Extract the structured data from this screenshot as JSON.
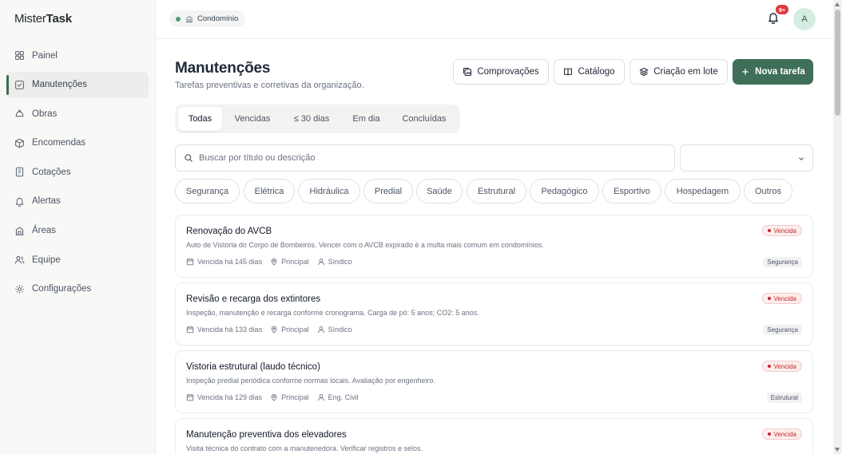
{
  "brand": {
    "part1": "Mister",
    "part2": "Task"
  },
  "sidebar": {
    "items": [
      {
        "label": "Painel",
        "icon": "grid-icon",
        "active": false
      },
      {
        "label": "Manutenções",
        "icon": "checkbox-icon",
        "active": true
      },
      {
        "label": "Obras",
        "icon": "helmet-icon",
        "active": false
      },
      {
        "label": "Encomendas",
        "icon": "package-icon",
        "active": false
      },
      {
        "label": "Cotações",
        "icon": "receipt-icon",
        "active": false
      },
      {
        "label": "Alertas",
        "icon": "bell-icon",
        "active": false
      },
      {
        "label": "Áreas",
        "icon": "building-icon",
        "active": false
      },
      {
        "label": "Equipe",
        "icon": "users-icon",
        "active": false
      },
      {
        "label": "Configurações",
        "icon": "gear-icon",
        "active": false
      }
    ]
  },
  "header": {
    "org_label": "Condomínio",
    "notification_badge": "9+",
    "avatar_initial": "A"
  },
  "page": {
    "title": "Manutenções",
    "subtitle": "Tarefas preventivas e corretivas da organização."
  },
  "actions": {
    "comprovacoes": "Comprovações",
    "catalogo": "Catálogo",
    "criacao_lote": "Criação em lote",
    "nova_tarefa": "Nova tarefa"
  },
  "tabs": [
    {
      "label": "Todas",
      "active": true
    },
    {
      "label": "Vencidas",
      "active": false
    },
    {
      "label": "≤ 30 dias",
      "active": false
    },
    {
      "label": "Em dia",
      "active": false
    },
    {
      "label": "Concluídas",
      "active": false
    }
  ],
  "search": {
    "placeholder": "Buscar por título ou descrição",
    "value": ""
  },
  "filter_select": {
    "value": ""
  },
  "categories": [
    "Segurança",
    "Elétrica",
    "Hidráulica",
    "Predial",
    "Saúde",
    "Estrutural",
    "Pedagógico",
    "Esportivo",
    "Hospedagem",
    "Outros"
  ],
  "tasks": [
    {
      "title": "Renovação do AVCB",
      "description": "Auto de Vistoria do Corpo de Bombeiros. Vencer com o AVCB expirado é a multa mais comum em condomínios.",
      "due": "Vencida há 145 dias",
      "location": "Principal",
      "responsible": "Síndico",
      "status": "Vencida",
      "category": "Segurança"
    },
    {
      "title": "Revisão e recarga dos extintores",
      "description": "Inspeção, manutenção e recarga conforme cronograma. Carga de pó: 5 anos; CO2: 5 anos.",
      "due": "Vencida há 133 dias",
      "location": "Principal",
      "responsible": "Síndico",
      "status": "Vencida",
      "category": "Segurança"
    },
    {
      "title": "Vistoria estrutural (laudo técnico)",
      "description": "Inspeção predial periódica conforme normas locais. Avaliação por engenheiro.",
      "due": "Vencida há 129 dias",
      "location": "Principal",
      "responsible": "Eng. Civil",
      "status": "Vencida",
      "category": "Estrutural"
    },
    {
      "title": "Manutenção preventiva dos elevadores",
      "description": "Visita técnica do contrato com a manutenedora. Verificar registros e selos.",
      "due": "",
      "location": "",
      "responsible": "",
      "status": "Vencida",
      "category": ""
    }
  ]
}
